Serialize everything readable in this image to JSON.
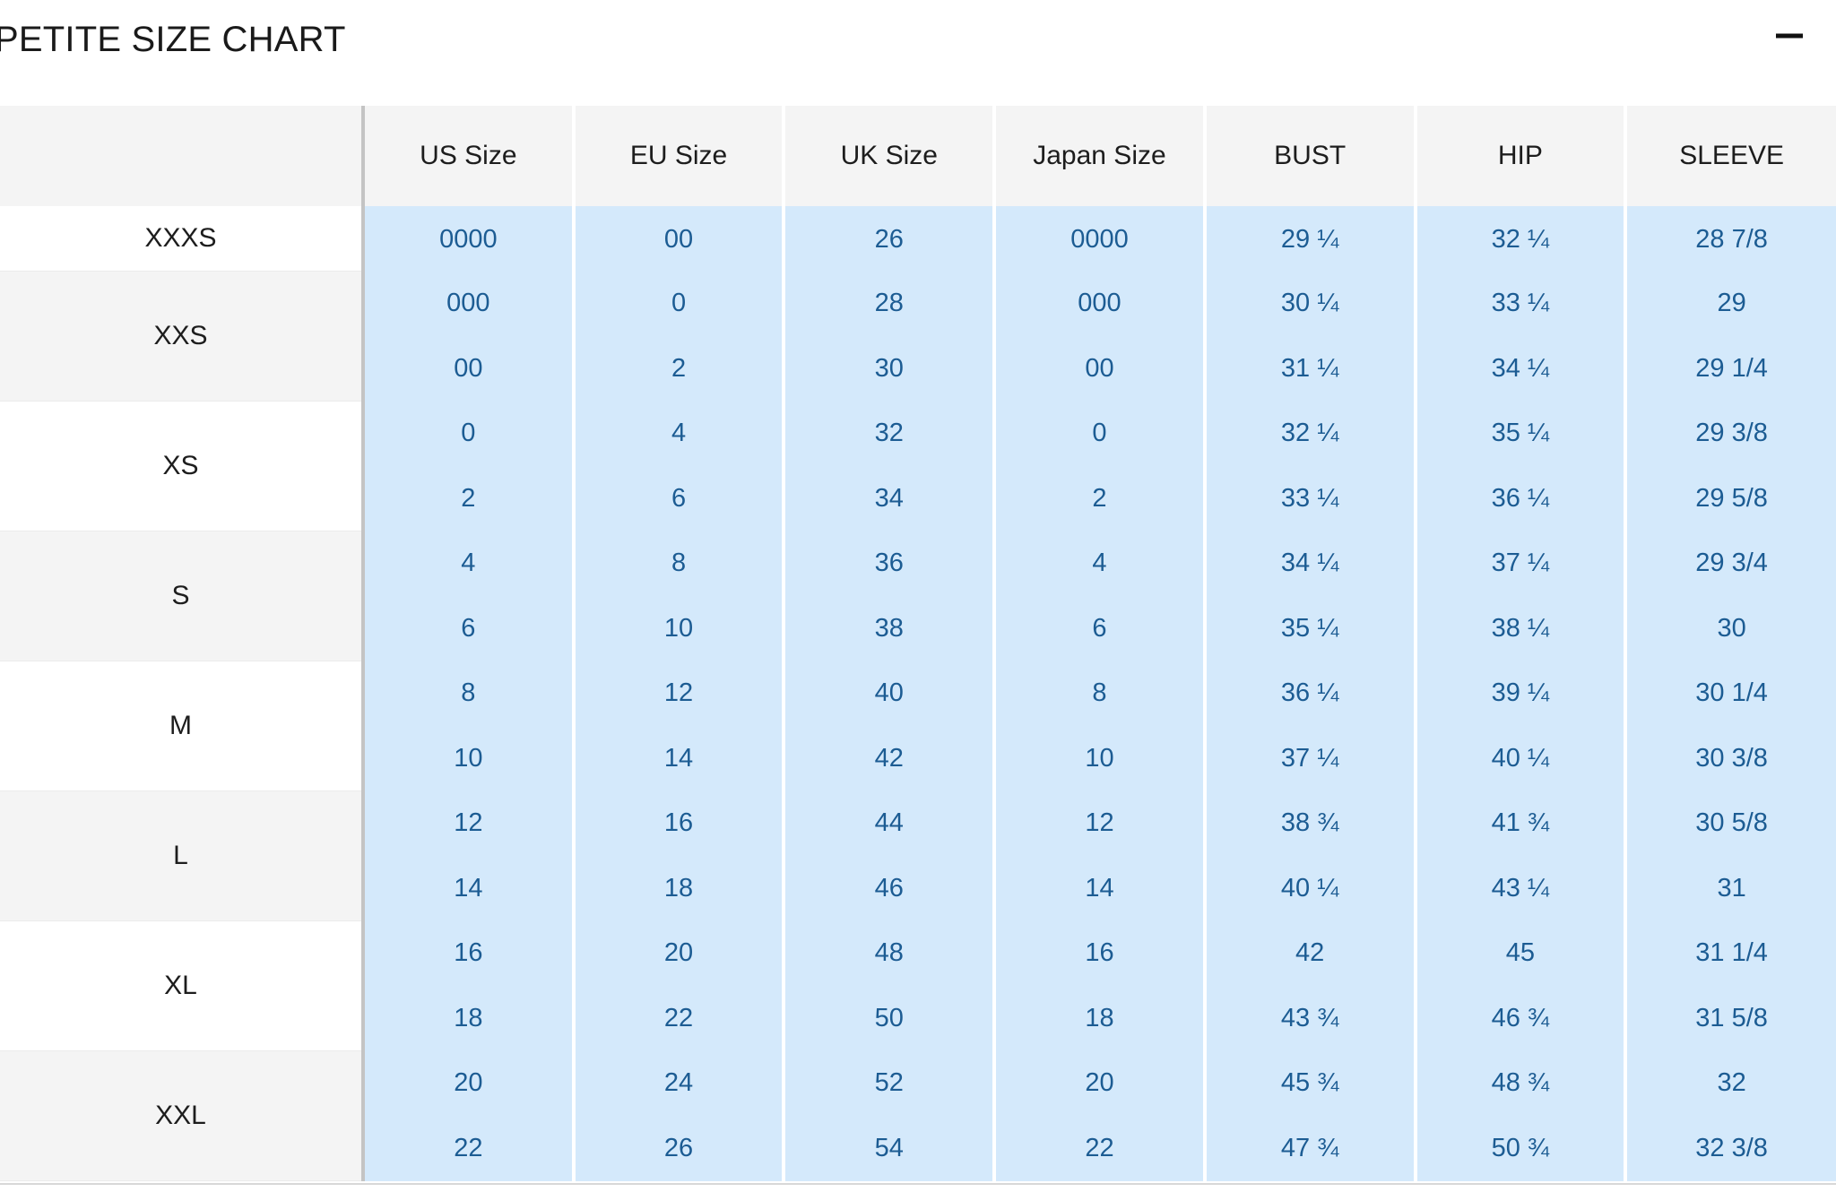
{
  "header": {
    "title": "PETITE SIZE CHART",
    "collapse_icon": "minus-icon"
  },
  "table": {
    "columns": [
      "US Size",
      "EU Size",
      "UK Size",
      "Japan Size",
      "BUST",
      "HIP",
      "SLEEVE"
    ],
    "size_groups": [
      {
        "label": "XXXS",
        "span": 1
      },
      {
        "label": "XXS",
        "span": 2
      },
      {
        "label": "XS",
        "span": 2
      },
      {
        "label": "S",
        "span": 2
      },
      {
        "label": "M",
        "span": 2
      },
      {
        "label": "L",
        "span": 2
      },
      {
        "label": "XL",
        "span": 2
      },
      {
        "label": "XXL",
        "span": 2
      }
    ],
    "rows": [
      [
        "0000",
        "00",
        "26",
        "0000",
        "29 ¼",
        "32 ¼",
        "28 7/8"
      ],
      [
        "000",
        "0",
        "28",
        "000",
        "30 ¼",
        "33 ¼",
        "29"
      ],
      [
        "00",
        "2",
        "30",
        "00",
        "31 ¼",
        "34 ¼",
        "29 1/4"
      ],
      [
        "0",
        "4",
        "32",
        "0",
        "32 ¼",
        "35 ¼",
        "29 3/8"
      ],
      [
        "2",
        "6",
        "34",
        "2",
        "33 ¼",
        "36 ¼",
        "29 5/8"
      ],
      [
        "4",
        "8",
        "36",
        "4",
        "34 ¼",
        "37 ¼",
        "29 3/4"
      ],
      [
        "6",
        "10",
        "38",
        "6",
        "35 ¼",
        "38 ¼",
        "30"
      ],
      [
        "8",
        "12",
        "40",
        "8",
        "36 ¼",
        "39 ¼",
        "30 1/4"
      ],
      [
        "10",
        "14",
        "42",
        "10",
        "37 ¼",
        "40 ¼",
        "30 3/8"
      ],
      [
        "12",
        "16",
        "44",
        "12",
        "38 ¾",
        "41 ¾",
        "30 5/8"
      ],
      [
        "14",
        "18",
        "46",
        "14",
        "40 ¼",
        "43 ¼",
        "31"
      ],
      [
        "16",
        "20",
        "48",
        "16",
        "42",
        "45",
        "31 1/4"
      ],
      [
        "18",
        "22",
        "50",
        "18",
        "43 ¾",
        "46 ¾",
        "31 5/8"
      ],
      [
        "20",
        "24",
        "52",
        "20",
        "45 ¾",
        "48 ¾",
        "32"
      ],
      [
        "22",
        "26",
        "54",
        "22",
        "47 ¾",
        "50 ¾",
        "32 3/8"
      ]
    ]
  },
  "colors": {
    "data_cell_bg": "#d4e9fb",
    "data_cell_text": "#1c5c93",
    "header_bg": "#f4f4f4",
    "label_alt_bg": "#f4f4f4",
    "divider": "#c4c4c4"
  }
}
